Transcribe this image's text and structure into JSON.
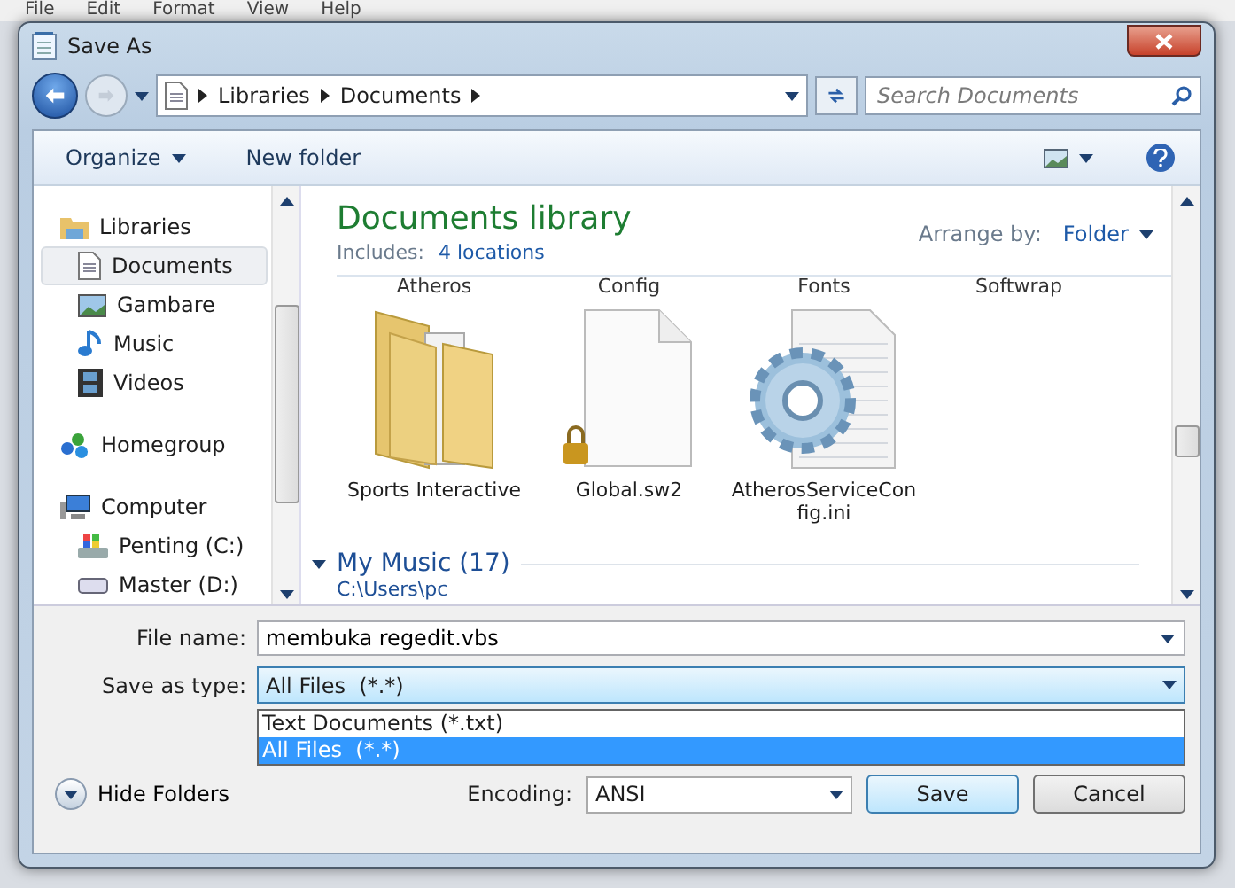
{
  "background_menu": [
    "File",
    "Edit",
    "Format",
    "View",
    "Help"
  ],
  "window": {
    "title": "Save As"
  },
  "address": {
    "crumbs": [
      "Libraries",
      "Documents"
    ]
  },
  "search": {
    "placeholder": "Search Documents"
  },
  "toolbar": {
    "organize": "Organize",
    "new_folder": "New folder"
  },
  "sidebar": {
    "items": [
      {
        "label": "Libraries",
        "kind": "library",
        "selected": false,
        "children": [
          {
            "label": "Documents",
            "kind": "document",
            "selected": true
          },
          {
            "label": "Gambare",
            "kind": "picture",
            "selected": false
          },
          {
            "label": "Music",
            "kind": "music",
            "selected": false
          },
          {
            "label": "Videos",
            "kind": "video",
            "selected": false
          }
        ]
      },
      {
        "label": "Homegroup",
        "kind": "homegroup",
        "selected": false
      },
      {
        "label": "Computer",
        "kind": "computer",
        "selected": false,
        "children": [
          {
            "label": "Penting (C:)",
            "kind": "system-drive",
            "selected": false
          },
          {
            "label": "Master (D:)",
            "kind": "drive",
            "selected": false
          }
        ]
      }
    ]
  },
  "library": {
    "title": "Documents library",
    "includes_label": "Includes:",
    "includes_link": "4 locations",
    "arrange_label": "Arrange by:",
    "arrange_value": "Folder"
  },
  "files": {
    "top_names": [
      "Atheros",
      "Config",
      "Fonts",
      "Softwrap"
    ],
    "items": [
      {
        "name": "Sports Interactive",
        "kind": "folder"
      },
      {
        "name": "Global.sw2",
        "kind": "locked"
      },
      {
        "name": "AtherosServiceConfig.ini",
        "kind": "config"
      }
    ]
  },
  "group": {
    "title": "My Music (17)",
    "path": "C:\\Users\\pc"
  },
  "form": {
    "file_name_label": "File name:",
    "file_name": "membuka regedit.vbs",
    "type_label": "Save as type:",
    "type_value": "All Files  (*.*)",
    "options": [
      {
        "label": "Text Documents (*.txt)",
        "selected": false
      },
      {
        "label": "All Files  (*.*)",
        "selected": true
      }
    ]
  },
  "footer": {
    "hide_folders": "Hide Folders",
    "encoding_label": "Encoding:",
    "encoding": "ANSI",
    "save": "Save",
    "cancel": "Cancel"
  }
}
